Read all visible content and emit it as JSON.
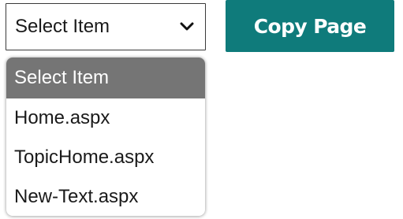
{
  "select": {
    "value": "Select Item",
    "icon": "chevron-down-icon"
  },
  "copy_button": {
    "label": "Copy Page",
    "background": "#0f7b7b",
    "text_color": "#ffffff"
  },
  "dropdown": {
    "options": [
      {
        "label": "Select Item",
        "highlighted": true
      },
      {
        "label": "Home.aspx",
        "highlighted": false
      },
      {
        "label": "TopicHome.aspx",
        "highlighted": false
      },
      {
        "label": "New-Text.aspx",
        "highlighted": false
      }
    ],
    "highlight_color": "#757575"
  }
}
